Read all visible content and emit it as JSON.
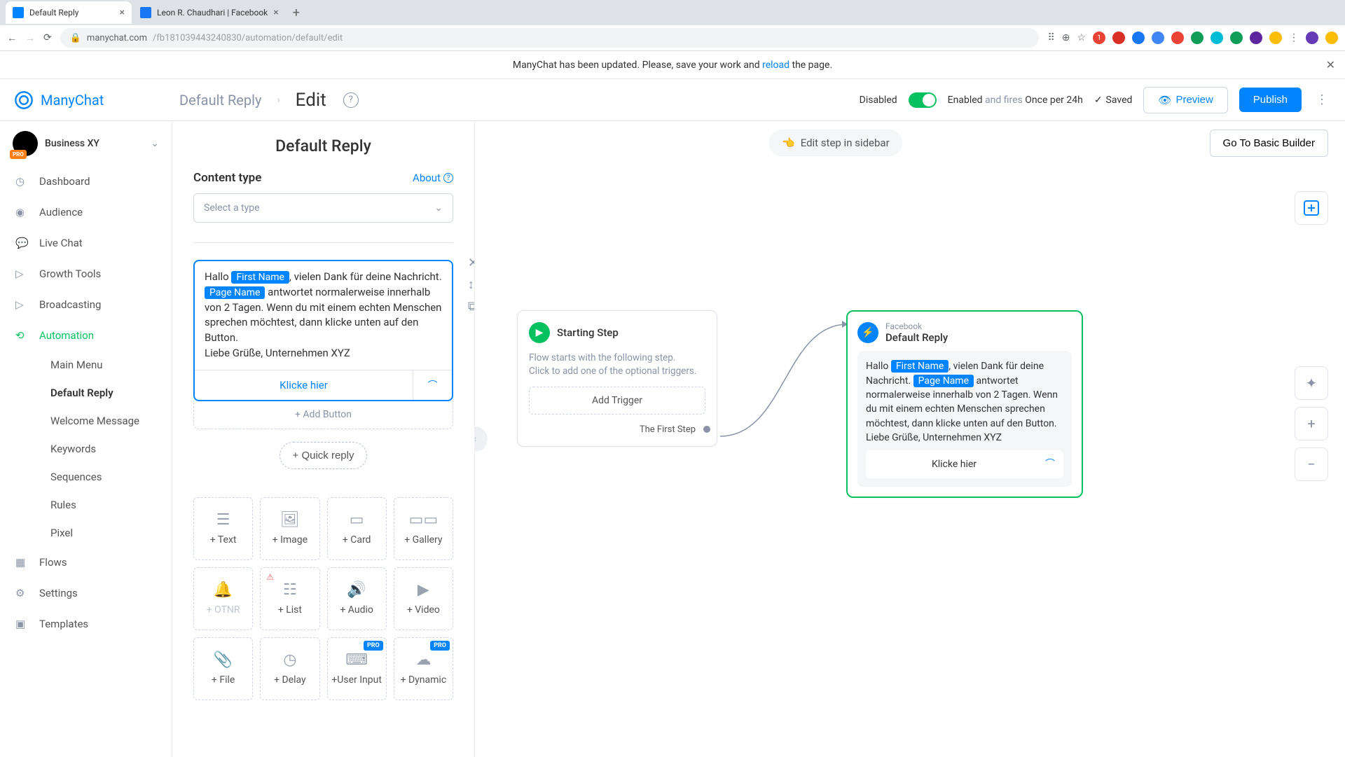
{
  "browser": {
    "tabs": [
      {
        "title": "Default Reply",
        "favicon": "#0084ff"
      },
      {
        "title": "Leon R. Chaudhari | Facebook",
        "favicon": "#1877f2"
      }
    ],
    "url_host": "manychat.com",
    "url_path": "/fb181039443240830/automation/default/edit"
  },
  "notify": {
    "prefix": "ManyChat has been updated. Please, save your work and ",
    "link": "reload",
    "suffix": " the page."
  },
  "header": {
    "app_name": "ManyChat",
    "breadcrumb": "Default Reply",
    "mode": "Edit",
    "disabled": "Disabled",
    "enabled": "Enabled",
    "fires_prefix": "and fires ",
    "fires_value": "Once per 24h",
    "saved": "Saved",
    "preview": "Preview",
    "publish": "Publish"
  },
  "workspace": {
    "name": "Business XY"
  },
  "nav": {
    "dashboard": "Dashboard",
    "audience": "Audience",
    "livechat": "Live Chat",
    "growth": "Growth Tools",
    "broadcasting": "Broadcasting",
    "automation": "Automation",
    "sub": {
      "main_menu": "Main Menu",
      "default_reply": "Default Reply",
      "welcome": "Welcome Message",
      "keywords": "Keywords",
      "sequences": "Sequences",
      "rules": "Rules",
      "pixel": "Pixel"
    },
    "flows": "Flows",
    "settings": "Settings",
    "templates": "Templates"
  },
  "editor": {
    "title": "Default Reply",
    "content_type_label": "Content type",
    "about": "About",
    "select_placeholder": "Select a type",
    "msg": {
      "t1": "Hallo ",
      "chip1": "First Name",
      "t2": ", vielen Dank für deine Nachricht. ",
      "chip2": "Page Name",
      "t3": " antwortet normalerweise innerhalb von 2 Tagen. Wenn du mit einem echten Menschen sprechen möchtest, dann klicke unten auf den Button.",
      "t4": "Liebe Grüße, Unternehmen XYZ",
      "button_label": "Klicke hier"
    },
    "add_button": "+ Add Button",
    "quick_reply": "+ Quick reply",
    "blocks": {
      "text": "+ Text",
      "image": "+ Image",
      "card": "+ Card",
      "gallery": "+ Gallery",
      "otnr": "+ OTNR",
      "list": "+ List",
      "audio": "+ Audio",
      "video": "+ Video",
      "file": "+ File",
      "delay": "+ Delay",
      "user_input": "+User Input",
      "dynamic": "+ Dynamic"
    },
    "pro_badge": "PRO"
  },
  "canvas": {
    "edit_step": "Edit step in sidebar",
    "go_basic": "Go To Basic Builder",
    "start_node": {
      "title": "Starting Step",
      "desc1": "Flow starts with the following step.",
      "desc2": "Click to add one of the optional triggers.",
      "add_trigger": "Add Trigger",
      "first_step": "The First Step"
    },
    "reply_node": {
      "platform": "Facebook",
      "name": "Default Reply",
      "t1": "Hallo ",
      "chip1": "First Name",
      "t2": ", vielen Dank für deine Nachricht. ",
      "chip2": "Page Name",
      "t3": " antwortet normalerweise innerhalb von 2 Tagen. Wenn du mit einem echten Menschen sprechen möchtest, dann klicke unten auf den Button.",
      "t4": "Liebe Grüße, Unternehmen XYZ",
      "button_label": "Klicke hier"
    }
  }
}
